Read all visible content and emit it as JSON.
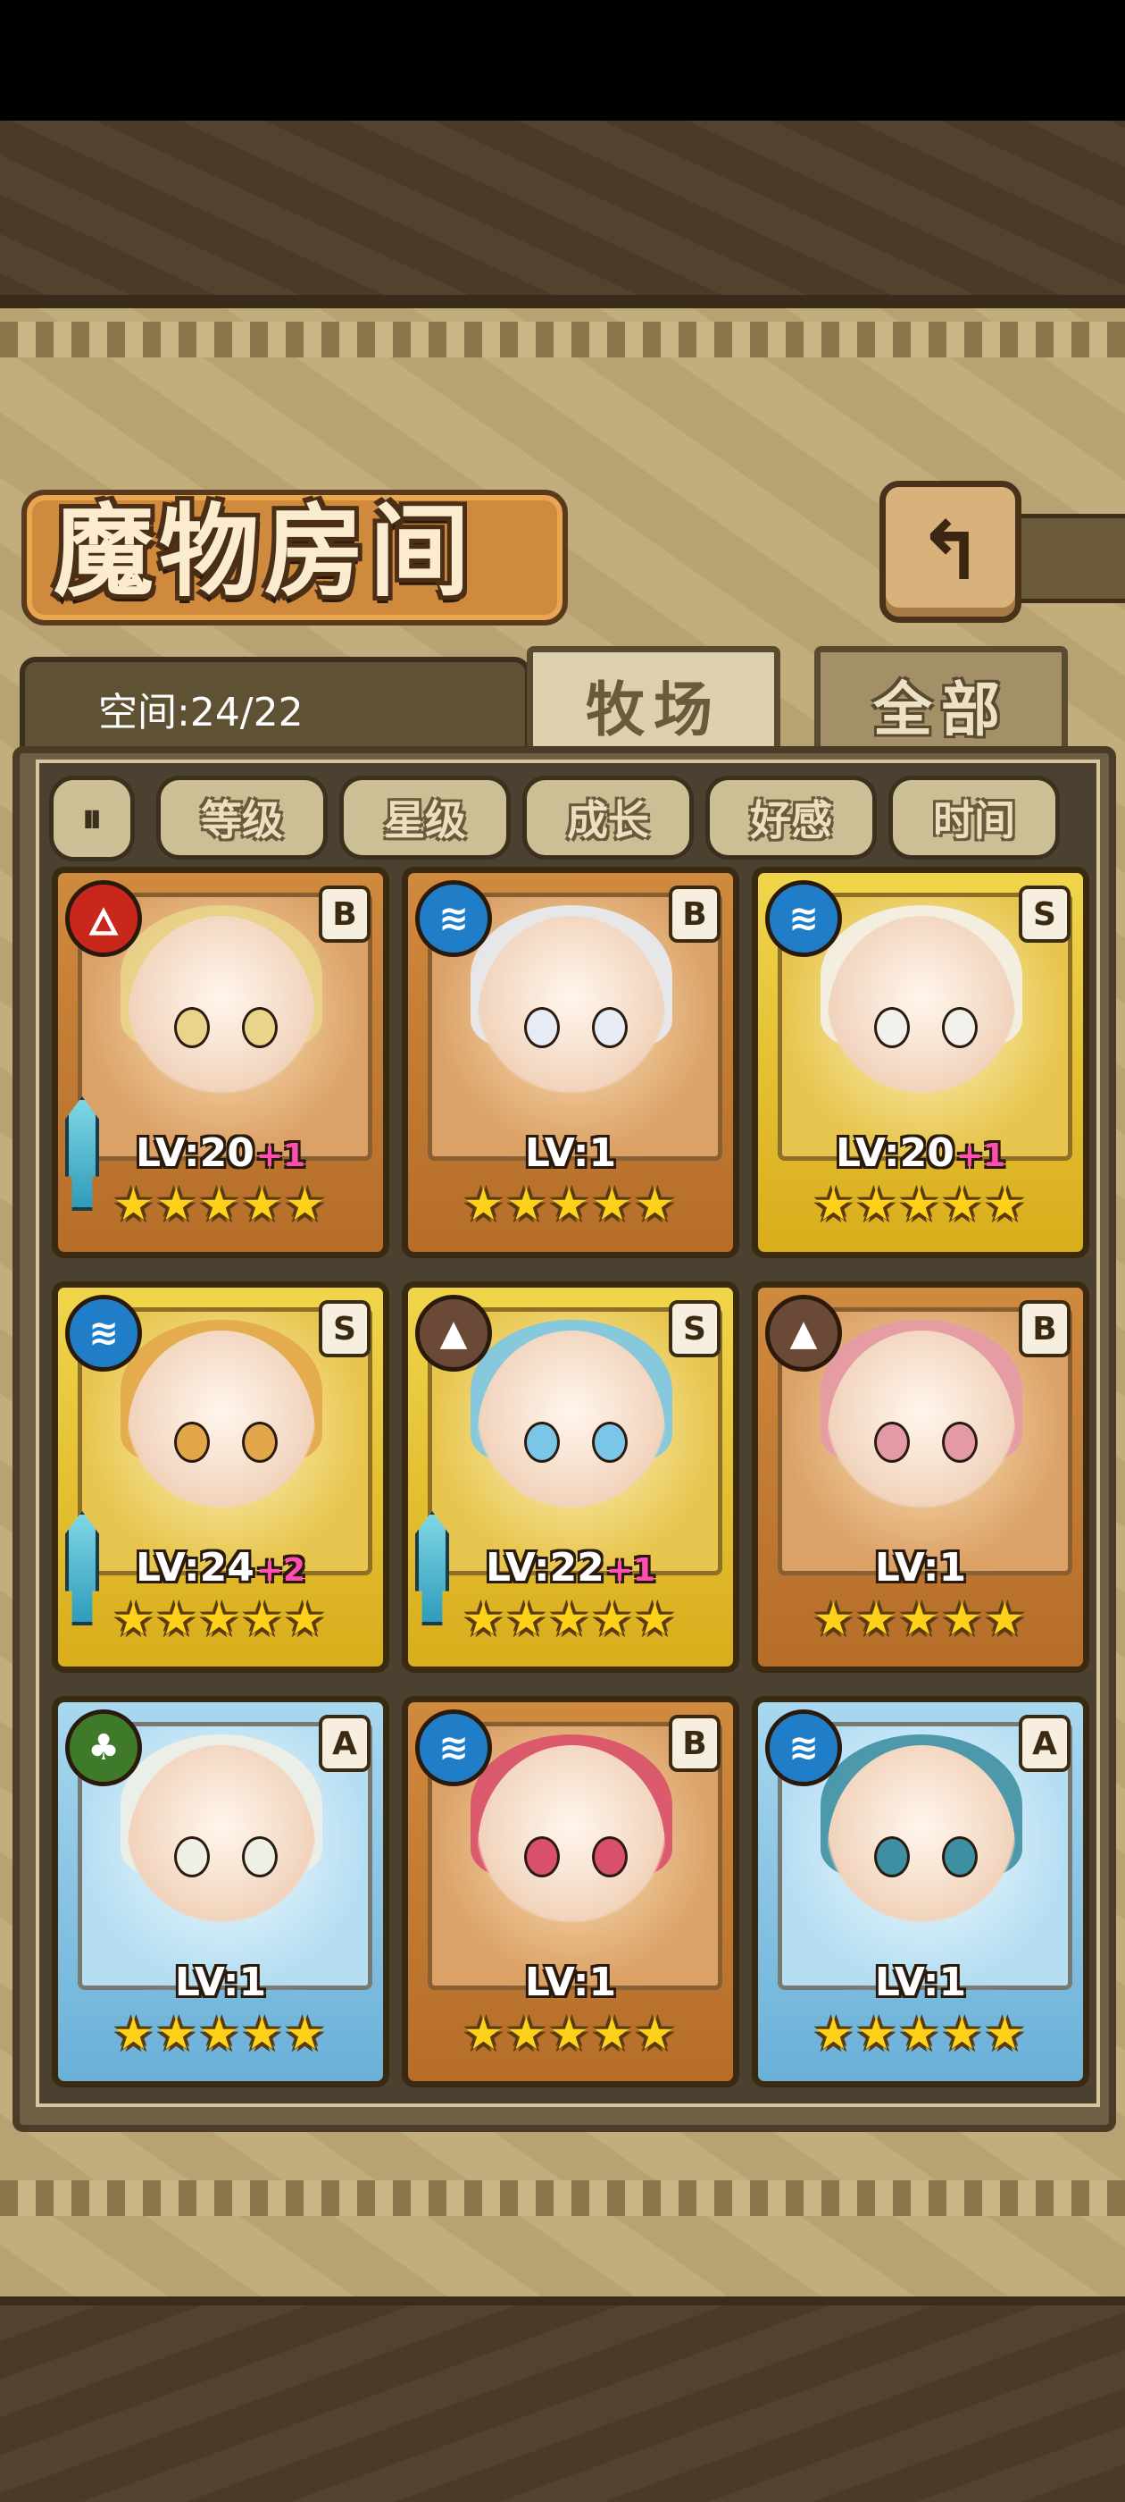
{
  "title": "魔物房间",
  "back_icon": "return-arrow-icon",
  "space_label": "空间:24/22",
  "tabs": [
    {
      "label": "牧场",
      "active": true
    },
    {
      "label": "全部",
      "active": false
    }
  ],
  "sort_toggle_icon": "sort-toggle-icon",
  "filters": [
    "等级",
    "星级",
    "成长",
    "好感",
    "时间"
  ],
  "monsters": [
    {
      "element": "fire",
      "element_icon": "fire-element-icon",
      "grade": "B",
      "frame": "bronze",
      "level": "LV:20",
      "bonus": "+1",
      "weapon": true,
      "stars": 5,
      "hair": "#e9d48a"
    },
    {
      "element": "water",
      "element_icon": "water-element-icon",
      "grade": "B",
      "frame": "bronze",
      "level": "LV:1",
      "bonus": "",
      "weapon": false,
      "stars": 5,
      "hair": "#e7ecf4"
    },
    {
      "element": "water",
      "element_icon": "water-element-icon",
      "grade": "S",
      "frame": "gold",
      "level": "LV:20",
      "bonus": "+1",
      "weapon": false,
      "stars": 5,
      "hair": "#f3f1ec"
    },
    {
      "element": "water",
      "element_icon": "water-element-icon",
      "grade": "S",
      "frame": "gold",
      "level": "LV:24",
      "bonus": "+2",
      "weapon": true,
      "stars": 5,
      "hair": "#e2a74a"
    },
    {
      "element": "earth",
      "element_icon": "earth-element-icon",
      "grade": "S",
      "frame": "gold",
      "level": "LV:22",
      "bonus": "+1",
      "weapon": true,
      "stars": 5,
      "hair": "#7ac6e8"
    },
    {
      "element": "earth",
      "element_icon": "earth-element-icon",
      "grade": "B",
      "frame": "bronze",
      "level": "LV:1",
      "bonus": "",
      "weapon": false,
      "stars": 5,
      "hair": "#e49aa6"
    },
    {
      "element": "wood",
      "element_icon": "wood-element-icon",
      "grade": "A",
      "frame": "silver",
      "level": "LV:1",
      "bonus": "",
      "weapon": false,
      "stars": 5,
      "hair": "#eef0e6"
    },
    {
      "element": "water",
      "element_icon": "water-element-icon",
      "grade": "B",
      "frame": "bronze",
      "level": "LV:1",
      "bonus": "",
      "weapon": false,
      "stars": 5,
      "hair": "#d9506a"
    },
    {
      "element": "water",
      "element_icon": "water-element-icon",
      "grade": "A",
      "frame": "silver",
      "level": "LV:1",
      "bonus": "",
      "weapon": false,
      "stars": 5,
      "hair": "#3f8fa3"
    }
  ]
}
